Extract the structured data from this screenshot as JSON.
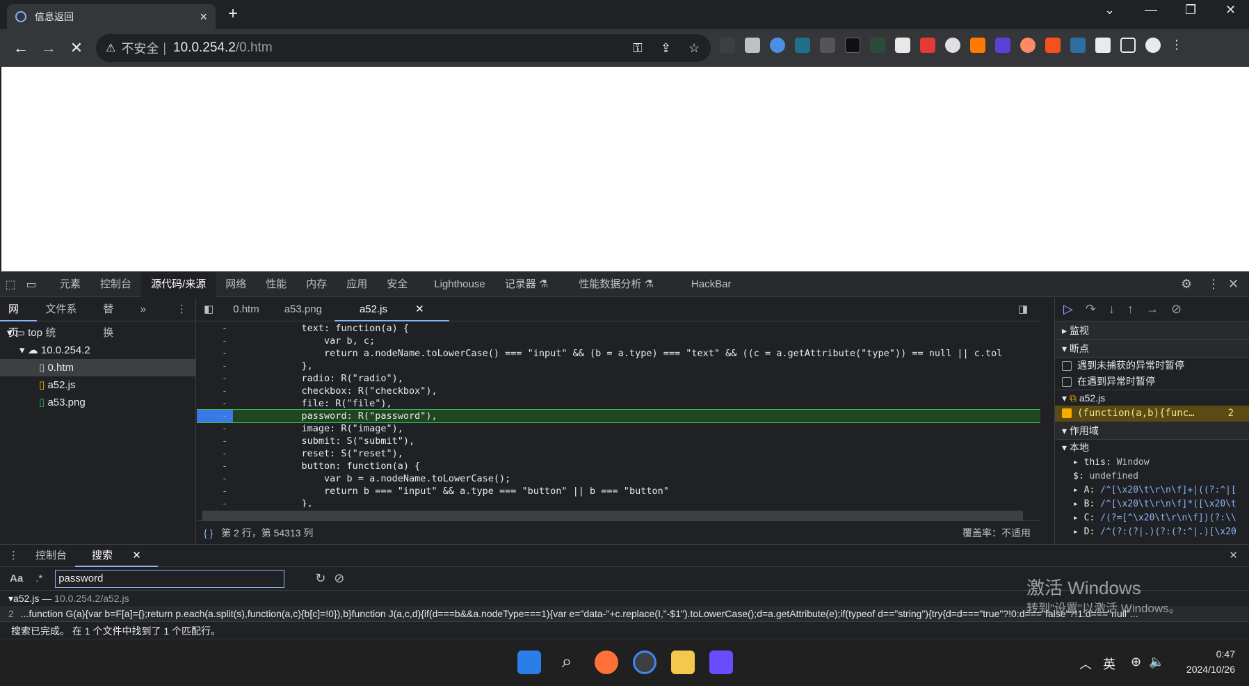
{
  "browser": {
    "tab_title": "信息返回",
    "omnibox": {
      "warning_label": "不安全",
      "host": "10.0.254.2",
      "path": "/0.htm"
    }
  },
  "devtools": {
    "main_tabs": [
      "元素",
      "控制台",
      "源代码/来源",
      "网络",
      "性能",
      "内存",
      "应用",
      "安全",
      "Lighthouse",
      "记录器 ⚗",
      "性能数据分析 ⚗",
      "HackBar"
    ],
    "left_tabs": [
      "网页",
      "文件系统",
      "替换",
      "»"
    ],
    "tree": {
      "top": "top",
      "host": "10.0.254.2",
      "files": [
        "0.htm",
        "a52.js",
        "a53.png"
      ]
    },
    "editor_tabs": [
      "0.htm",
      "a53.png",
      "a52.js"
    ],
    "code_lines": [
      "text: function(a) {",
      "    var b, c;",
      "    return a.nodeName.toLowerCase() === \"input\" && (b = a.type) === \"text\" && ((c = a.getAttribute(\"type\")) == null || c.tol",
      "},",
      "radio: R(\"radio\"),",
      "checkbox: R(\"checkbox\"),",
      "file: R(\"file\"),",
      "password: R(\"password\"),",
      "image: R(\"image\"),",
      "submit: S(\"submit\"),",
      "reset: S(\"reset\"),",
      "button: function(a) {",
      "    var b = a.nodeName.toLowerCase();",
      "    return b === \"input\" && a.type === \"button\" || b === \"button\"",
      "},"
    ],
    "highlight_line_index": 7,
    "status_position": "第 2 行，第 54313 列",
    "status_coverage": "覆盖率：不适用",
    "right_panel": {
      "watch": "监视",
      "breakpoints": "断点",
      "pause_uncaught": "遇到未捕获的异常时暂停",
      "pause_caught": "在遇到异常时暂停",
      "bp_file": "a52.js",
      "bp_code": "(function(a,b){func…",
      "bp_line": "2",
      "scope": "作用域",
      "local": "本地",
      "scope_vars": [
        {
          "name": "this:",
          "value": "Window"
        },
        {
          "name": "$:",
          "value": "undefined"
        },
        {
          "name": "A:",
          "value": "/^[\\x20\\t\\r\\n\\f]+|((?:^|["
        },
        {
          "name": "B:",
          "value": "/^[\\x20\\t\\r\\n\\f]*([\\x20\\t"
        },
        {
          "name": "C:",
          "value": "/(?=[^\\x20\\t\\r\\n\\f])(?:\\\\"
        },
        {
          "name": "D:",
          "value": "/^(?:(?|.)(?:(?:^|.)[\\x20"
        }
      ]
    },
    "drawer": {
      "tabs": [
        "控制台",
        "搜索"
      ],
      "search_value": "password",
      "result_file": "a52.js",
      "result_path": "10.0.254.2/a52.js",
      "result_line_no": "2",
      "result_text": "...function G(a){var b=F[a]={};return p.each(a.split(s),function(a,c){b[c]=!0}),b}function J(a,c,d){if(d===b&&a.nodeType===1){var e=\"data-\"+c.replace(I,\"-$1\").toLowerCase();d=a.getAttribute(e);if(typeof d==\"string\"){try{d=d===\"true\"?!0:d===\"false\"?!1:d===\"null\"...",
      "status": "搜索已完成。 在 1 个文件中找到了 1 个匹配行。"
    }
  },
  "watermark": {
    "line1": "激活 Windows",
    "line2": "转到\"设置\"以激活 Windows。"
  },
  "taskbar": {
    "ime": "英",
    "time": "0:47",
    "date": "2024/10/26"
  },
  "colors": {
    "accent": "#8ab4f8",
    "highlight": "#1e4620",
    "breakpoint": "#3b78e7"
  }
}
